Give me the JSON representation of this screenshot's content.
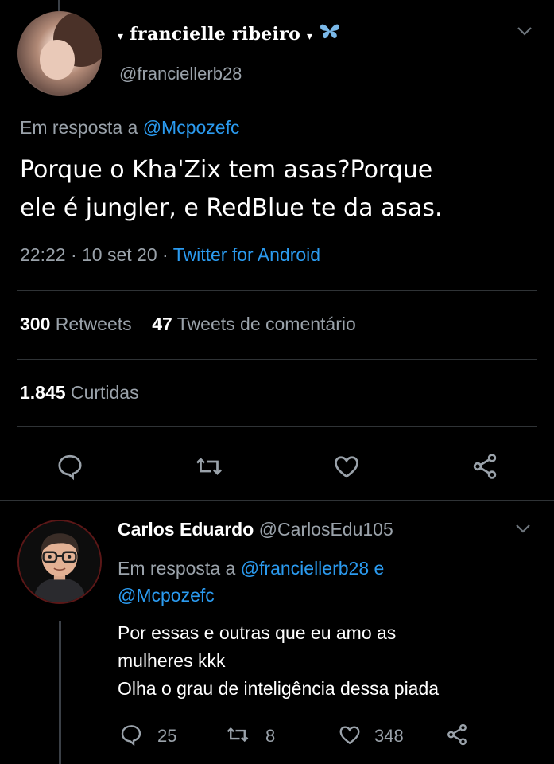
{
  "tweet": {
    "display_name": "francielle ribeiro",
    "name_decor_left": "▾",
    "name_decor_right": "▾",
    "handle": "@franciellerb28",
    "reply_prefix": "Em resposta a",
    "reply_mention": "@Mcpozefc",
    "text_line1": "Porque o Kha'Zix tem asas?Porque",
    "text_line2": "ele é jungler, e RedBlue te da asas.",
    "time": "22:22",
    "date": "10 set 20",
    "source": "Twitter for Android",
    "retweets_count": "300",
    "retweets_label": "Retweets",
    "comments_count": "47",
    "comments_label": "Tweets de comentário",
    "likes_count": "1.845",
    "likes_label": "Curtidas"
  },
  "reply": {
    "display_name": "Carlos Eduardo",
    "handle": "@CarlosEdu105",
    "reply_prefix": "Em resposta a",
    "mention1": "@franciellerb28",
    "conj": "e",
    "mention2": "@Mcpozefc",
    "line1": "Por essas e outras que eu amo as",
    "line2": "mulheres kkk",
    "line3": "Olha o grau de inteligência dessa piada",
    "replies": "25",
    "retweets": "8",
    "likes": "348"
  },
  "colors": {
    "accent": "#2b9bf0",
    "muted": "#9aa2aa",
    "bg": "#000000"
  },
  "icons": [
    "chevron-down-icon",
    "butterfly-icon",
    "reply-icon",
    "retweet-icon",
    "like-icon",
    "share-icon"
  ]
}
